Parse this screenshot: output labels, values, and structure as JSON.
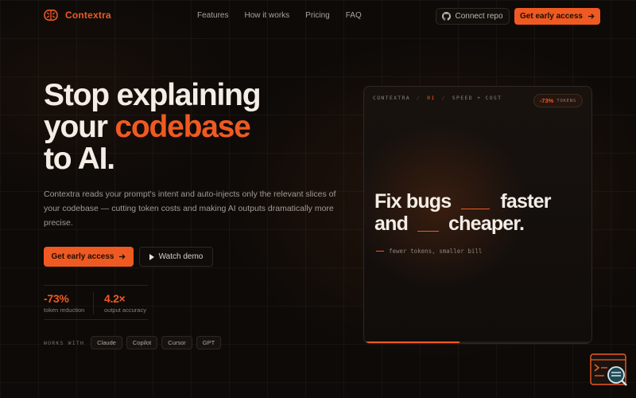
{
  "brand": {
    "name": "Contextra",
    "accent": "#ef5a22"
  },
  "nav": {
    "links": [
      "Features",
      "How it works",
      "Pricing",
      "FAQ"
    ],
    "connect_label": "Connect repo",
    "connect_icon": "github-icon",
    "cta_label": "Get early access",
    "cta_icon": "arrow-right-icon"
  },
  "hero": {
    "title_line1": "Stop explaining",
    "title_line2_plain": "your ",
    "title_line2_accent": "codebase",
    "title_line3": "to AI.",
    "description": "Contextra reads your prompt's intent and auto-injects only the relevant slices of your codebase — cutting token costs and making AI outputs dramatically more precise.",
    "primary_label": "Get early access",
    "demo_label": "Watch demo",
    "stats": [
      {
        "value": "-73%",
        "label": "token reduction"
      },
      {
        "value": "4.2×",
        "label": "output accuracy"
      }
    ],
    "works_with_label": "WORKS WITH",
    "integrations": [
      "Claude",
      "Copilot",
      "Cursor",
      "GPT"
    ]
  },
  "card": {
    "brand": "CONTEXTRA",
    "slide_number": "01",
    "separator": "/",
    "topic": "SPEED + COST",
    "badge_value": "-73%",
    "badge_unit": "TOKENS",
    "line1_start": "Fix bugs",
    "line1_end": "faster",
    "line2_start": "and",
    "line2_end": "cheaper.",
    "caption": "fewer tokens, smaller bill",
    "progress": 0.42
  },
  "corner_widget": {
    "icon": "terminal-search-icon"
  }
}
